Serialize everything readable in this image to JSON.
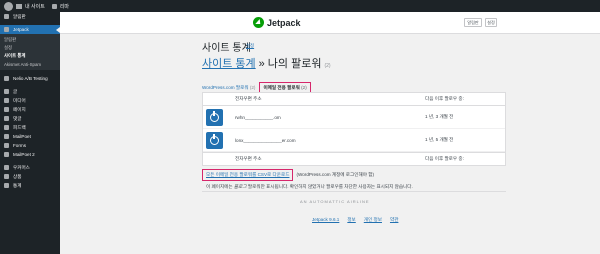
{
  "adminbar": {
    "site_name": "내 사이트",
    "comments": "리마"
  },
  "sidebar": {
    "items_top": [
      {
        "label": "알림판"
      },
      {
        "label": "Jetpack",
        "active": true
      }
    ],
    "jetpack_sub": [
      {
        "label": "알림판"
      },
      {
        "label": "설정"
      },
      {
        "label": "사이트 통계",
        "current": true
      },
      {
        "label": "Akismet Anti-Spam"
      }
    ],
    "items_bottom": [
      {
        "label": "Nelio A/B Testing"
      },
      {
        "label": "글"
      },
      {
        "label": "미디어"
      },
      {
        "label": "페이지"
      },
      {
        "label": "댓글"
      },
      {
        "label": "피드백"
      },
      {
        "label": "MailPoet"
      },
      {
        "label": "Forms"
      },
      {
        "label": "MailPoet 2"
      },
      {
        "label": "우커머스"
      },
      {
        "label": "상품"
      },
      {
        "label": "통계"
      }
    ]
  },
  "header": {
    "brand": "Jetpack",
    "help_label": "알림판",
    "settings_label": "설정"
  },
  "page": {
    "title": "사이트 통계",
    "title_link": "설정",
    "breadcrumb_link": "사이트 통계",
    "breadcrumb_sep": "»",
    "breadcrumb_current": "나의 팔로워",
    "breadcrumb_count": "(2)",
    "tab_wpcom_label": "WordPress.com 팔로워",
    "tab_wpcom_count": "(2)",
    "tab_email_label": "이메일 전용 팔로워",
    "tab_email_count": "(2)"
  },
  "table": {
    "col_email": "전자우편 주소",
    "col_since": "다음 이후 팔로우 중:",
    "rows": [
      {
        "email": "rwhn___________.om",
        "since": "1 년, 3 개월 전"
      },
      {
        "email": "lonx_______________er.com",
        "since": "1 년, 5 개월 전"
      }
    ]
  },
  "download": {
    "link": "모든 이메일 전용 팔로워를 CSV로 다운로드",
    "note": "(WordPress.com 계정에 로그인해야 함)"
  },
  "info": {
    "prefix": "이 페이지에는",
    "highlight": "블로그",
    "suffix": "팔로워만 표시됩니다. 확인하지 않았거나 팔로우를 차단한 사용자는 표시되지 않습니다."
  },
  "footer": {
    "automattic": "AN AUTOMATTIC AIRLINE",
    "links": [
      "Jetpack 9.6.1",
      "정보",
      "개인 정보",
      "약관"
    ]
  }
}
